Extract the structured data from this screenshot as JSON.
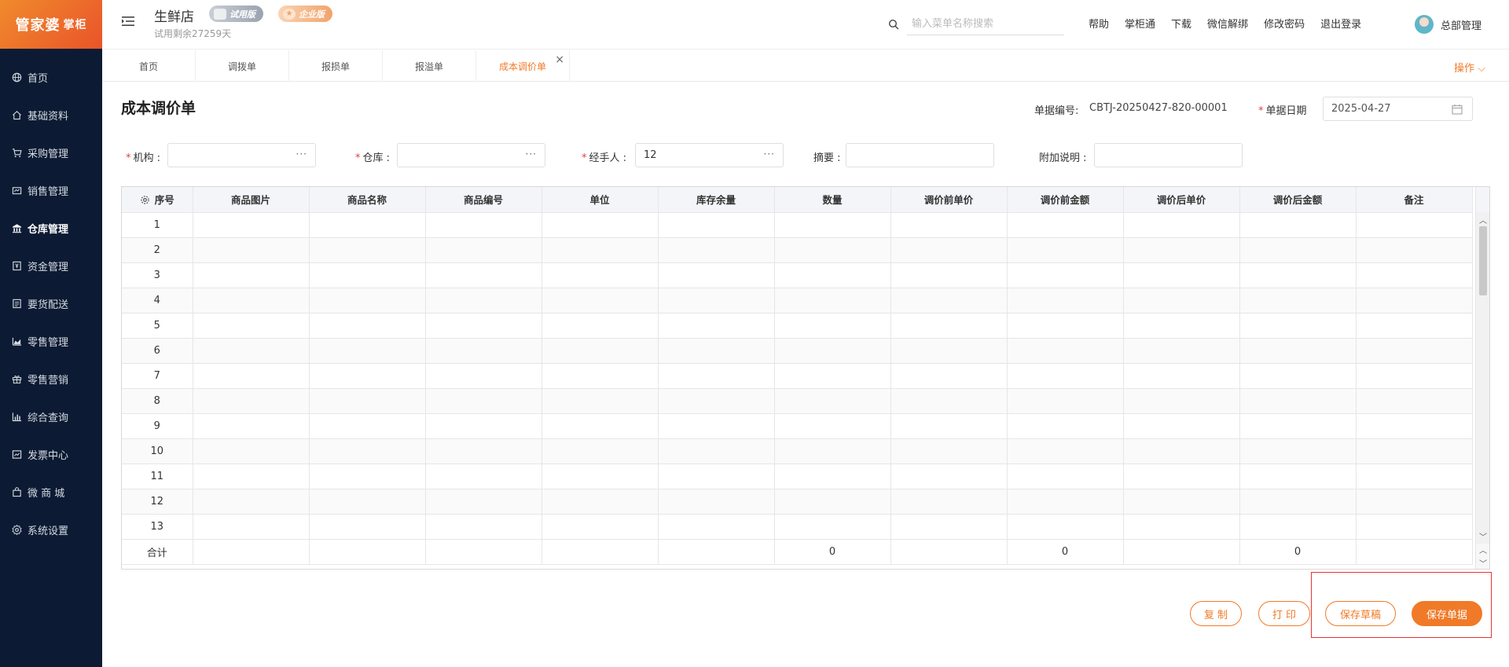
{
  "brand": {
    "logo_text": "管家婆",
    "logo_sub": "掌柜",
    "accent": "#f07a28"
  },
  "sidebar": {
    "items": [
      {
        "label": "首页",
        "icon": "globe-icon"
      },
      {
        "label": "基础资料",
        "icon": "home-icon"
      },
      {
        "label": "采购管理",
        "icon": "cart-icon"
      },
      {
        "label": "销售管理",
        "icon": "sales-icon"
      },
      {
        "label": "仓库管理",
        "icon": "warehouse-icon",
        "active": true
      },
      {
        "label": "资金管理",
        "icon": "money-icon"
      },
      {
        "label": "要货配送",
        "icon": "list-icon"
      },
      {
        "label": "零售管理",
        "icon": "chart-area-icon"
      },
      {
        "label": "零售营销",
        "icon": "gift-icon"
      },
      {
        "label": "综合查询",
        "icon": "bar-chart-icon"
      },
      {
        "label": "发票中心",
        "icon": "invoice-icon"
      },
      {
        "label": "微 商 城",
        "icon": "bag-icon"
      },
      {
        "label": "系统设置",
        "icon": "gear-icon"
      }
    ]
  },
  "header": {
    "store_name": "生鲜店",
    "trial_remaining": "试用剩余27259天",
    "badge_trial": "试用版",
    "badge_enterprise": "企业版",
    "search_placeholder": "输入菜单名称搜索",
    "links": [
      "帮助",
      "掌柜通",
      "下载",
      "微信解绑",
      "修改密码",
      "退出登录"
    ],
    "user_name": "总部管理"
  },
  "tabs": [
    {
      "label": "首页"
    },
    {
      "label": "调拨单"
    },
    {
      "label": "报损单"
    },
    {
      "label": "报溢单"
    },
    {
      "label": "成本调价单",
      "active": true,
      "closable": true
    }
  ],
  "ops_label": "操作 ⌵",
  "form": {
    "title": "成本调价单",
    "doc_no_label": "单据编号:",
    "doc_no": "CBTJ-20250427-820-00001",
    "date_label": "单据日期",
    "date": "2025-04-27",
    "org_label": "机构",
    "org_value": "",
    "warehouse_label": "仓库",
    "warehouse_value": "",
    "handler_label": "经手人",
    "handler_value": "12",
    "summary_label": "摘要",
    "summary_value": "",
    "note_label": "附加说明",
    "note_value": ""
  },
  "table": {
    "columns": [
      "序号",
      "商品图片",
      "商品名称",
      "商品编号",
      "单位",
      "库存余量",
      "数量",
      "调价前单价",
      "调价前金额",
      "调价后单价",
      "调价后金额",
      "备注"
    ],
    "rows": [
      1,
      2,
      3,
      4,
      5,
      6,
      7,
      8,
      9,
      10,
      11,
      12,
      13
    ],
    "footer": {
      "label": "合计",
      "qty_total": "0",
      "before_amount_total": "0",
      "after_amount_total": "0"
    }
  },
  "buttons": {
    "copy": "复 制",
    "print": "打 印",
    "save_draft": "保存草稿",
    "save_doc": "保存单据"
  }
}
